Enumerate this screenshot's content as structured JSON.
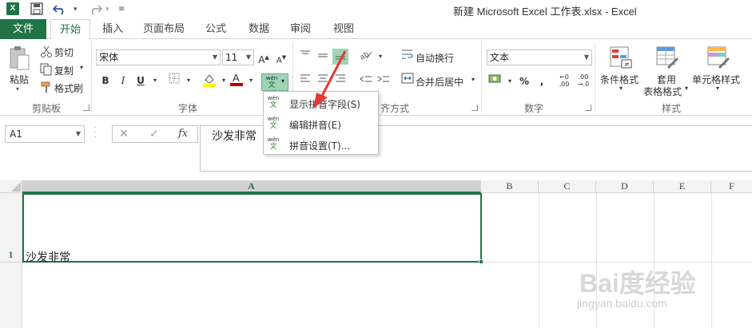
{
  "window": {
    "title": "新建 Microsoft Excel 工作表.xlsx - Excel",
    "app_icon": "X"
  },
  "tabs": [
    "文件",
    "开始",
    "插入",
    "页面布局",
    "公式",
    "数据",
    "审阅",
    "视图"
  ],
  "active_tab": "开始",
  "clipboard": {
    "paste": "粘贴",
    "cut": "剪切",
    "copy": "复制",
    "format_painter": "格式刷",
    "label": "剪贴板"
  },
  "font": {
    "name": "宋体",
    "size": "11",
    "label": "字体",
    "font_color": "#c00000",
    "highlight_color": "#ffff00"
  },
  "alignment": {
    "wrap_text": "自动换行",
    "merge_center": "合并后居中",
    "label": "齐方式"
  },
  "number": {
    "format": "文本",
    "label": "数字"
  },
  "styles": {
    "conditional": "条件格式",
    "table_format_1": "套用",
    "table_format_2": "表格格式",
    "cell_styles": "单元格样式",
    "label": "样式"
  },
  "phonetic_menu": {
    "button_text": "wén",
    "items": [
      {
        "label": "显示拼音字段(S)",
        "icon": "phonetic-show-icon"
      },
      {
        "label": "编辑拼音(E)",
        "icon": "phonetic-edit-icon"
      },
      {
        "label": "拼音设置(T)...",
        "icon": "phonetic-settings-icon"
      }
    ],
    "icon_top": "wén",
    "icon_bottom": "文"
  },
  "formula_bar": {
    "name_box": "A1",
    "cancel": "✕",
    "enter": "✓",
    "fx": "fx",
    "content": "沙发非常"
  },
  "grid": {
    "columns": [
      "A",
      "B",
      "C",
      "D",
      "E",
      "F"
    ],
    "selected_column": "A",
    "rows": [
      "1"
    ],
    "cell_a1": "沙发非常"
  },
  "watermark": {
    "brand": "Bai度经验",
    "url": "jingyan.baidu.com"
  },
  "colors": {
    "accent": "#217346",
    "arrow": "#e53935"
  }
}
